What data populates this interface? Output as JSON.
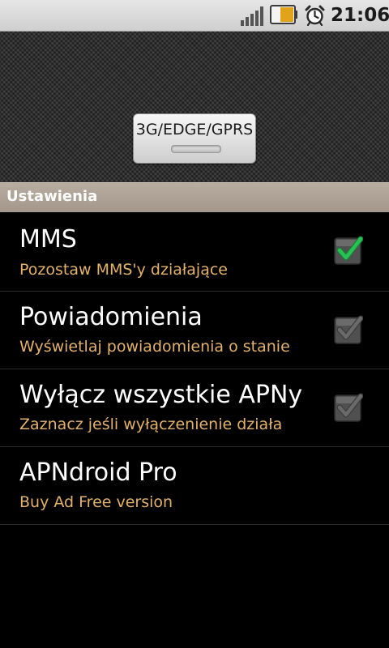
{
  "status_bar": {
    "time": "21:06",
    "icons": [
      "signal-icon",
      "battery-icon",
      "alarm-icon"
    ],
    "battery_color": "#e0a31a"
  },
  "widget": {
    "toggle_label": "3G/EDGE/GPRS"
  },
  "section": {
    "title": "Ustawienia",
    "color": "#a99e91"
  },
  "preferences": [
    {
      "title": "MMS",
      "summary": "Pozostaw MMS'y działające",
      "checked": true
    },
    {
      "title": "Powiadomienia",
      "summary": "Wyświetlaj powiadomienia o stanie",
      "checked": false
    },
    {
      "title": "Wyłącz wszystkie APNy",
      "summary": "Zaznacz jeśli wyłączenienie działa",
      "checked": false
    },
    {
      "title": "APNdroid Pro",
      "summary": "Buy Ad Free version"
    }
  ],
  "colors": {
    "summary_text": "#e3b26a",
    "check_green": "#21b24a",
    "check_grey": "#6a6a6a"
  }
}
